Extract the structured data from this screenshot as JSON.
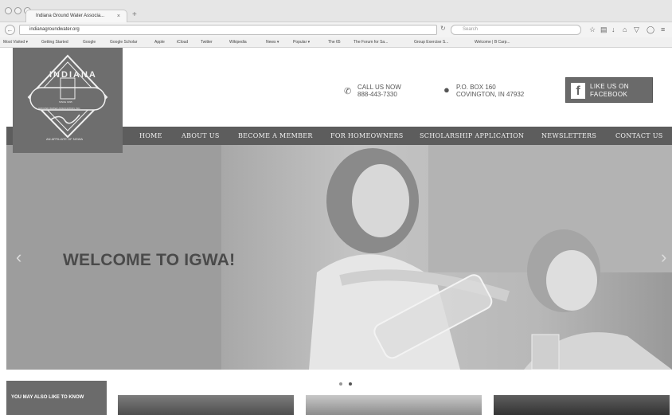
{
  "browser": {
    "tab_title": "Indiana Ground Water Associa...",
    "tab_close": "×",
    "new_tab": "+",
    "url": "indianagroundwater.org",
    "search_placeholder": "Search",
    "bookmarks": [
      "Most Visited ▾",
      "Getting Started",
      "Google",
      "Google Scholar",
      "Apple",
      "iCloud",
      "Twitter",
      "Wikipedia",
      "News ▾",
      "Popular ▾",
      "The 65",
      "The Forum for Sa...",
      "Group Exercise S...",
      "Welcome | B Carp..."
    ]
  },
  "logo": {
    "name": "INDIANA",
    "tagline": "GROUND WATER ASSOCIATION, INC.",
    "since": "SINCE 1995",
    "affiliate": "AN AFFILIATE OF NGWA"
  },
  "header": {
    "phone_label": "CALL US NOW",
    "phone_number": "888-443-7330",
    "address_line1": "P.O. BOX 160",
    "address_line2": "COVINGTON, IN 47932",
    "facebook_line1": "LIKE US ON",
    "facebook_line2": "FACEBOOK"
  },
  "nav": [
    "HOME",
    "ABOUT US",
    "BECOME A MEMBER",
    "FOR HOMEOWNERS",
    "SCHOLARSHIP APPLICATION",
    "NEWSLETTERS",
    "CONTACT US"
  ],
  "hero": {
    "headline": "WELCOME TO IGWA!",
    "prev": "‹",
    "next": "›"
  },
  "section": {
    "also_like": "YOU MAY ALSO LIKE TO KNOW"
  },
  "colors": {
    "nav_bg": "#5d5d5d",
    "logo_bg": "#6e6e6e",
    "hero_text": "#4a4a4a"
  }
}
